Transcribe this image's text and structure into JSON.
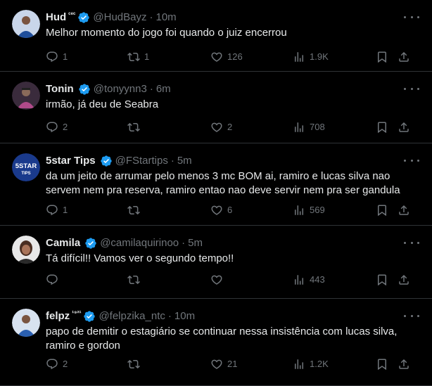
{
  "tweets": [
    {
      "name": "Hud",
      "name_suffix": "ᶜᵉᶜ",
      "handle": "@HudBayz",
      "time": "10m",
      "text": "Melhor momento do jogo foi quando o juiz encerrou",
      "replies": "1",
      "retweets": "1",
      "likes": "126",
      "views": "1.9K",
      "avatar_colors": [
        "#1f4e9a",
        "#c9d6ea"
      ]
    },
    {
      "name": "Tonin",
      "name_suffix": "",
      "handle": "@tonyynn3",
      "time": "6m",
      "text": "irmão, já deu de Seabra",
      "replies": "2",
      "retweets": "",
      "likes": "2",
      "views": "708",
      "avatar_colors": [
        "#3a2b3c",
        "#b04a8a"
      ]
    },
    {
      "name": "5star Tips",
      "name_suffix": "",
      "handle": "@FStartips",
      "time": "5m",
      "text": "da um jeito de arrumar pelo menos 3 mc BOM ai, ramiro e lucas silva nao servem nem pra reserva, ramiro entao nao deve servir nem pra ser gandula",
      "replies": "1",
      "retweets": "",
      "likes": "6",
      "views": "569",
      "avatar_text": "5STAR",
      "avatar_subtext": "TIPS",
      "avatar_colors": [
        "#1a3a8c",
        "#ffffff"
      ]
    },
    {
      "name": "Camila",
      "name_suffix": "",
      "handle": "@camilaquirinoo",
      "time": "5m",
      "text": "Tá difícil!! Vamos ver o segundo tempo!!",
      "replies": "",
      "retweets": "",
      "likes": "",
      "views": "443",
      "avatar_colors": [
        "#e8e8e8",
        "#4a2e22"
      ]
    },
    {
      "name": "felpz",
      "name_suffix": "¹⁹²¹",
      "handle": "@felpzika_ntc",
      "time": "10m",
      "text": "papo de demitir o estagiário se continuar nessa insistência com lucas silva, ramiro e gordon",
      "replies": "2",
      "retweets": "",
      "likes": "21",
      "views": "1.2K",
      "avatar_colors": [
        "#2a5fb0",
        "#d8e2f0"
      ]
    }
  ],
  "separator": "·",
  "colors": {
    "background": "#000000",
    "text": "#e7e9ea",
    "muted": "#71767b",
    "divider": "#2f3336",
    "verified": "#1d9bf0"
  },
  "icons": [
    "verified-badge-icon",
    "more-icon",
    "reply-icon",
    "retweet-icon",
    "like-icon",
    "views-icon",
    "bookmark-icon",
    "share-icon"
  ]
}
